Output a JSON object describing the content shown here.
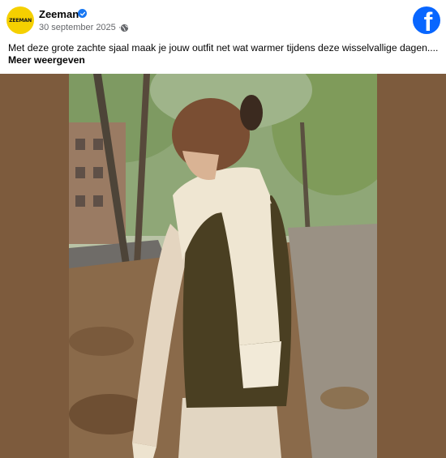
{
  "post": {
    "page_name": "Zeeman",
    "avatar_text": "ZEEMAN",
    "date": "30 september 2025 · ",
    "caption": "Met deze grote zachte sjaal maak je jouw outfit net wat warmer tijdens deze wisselvallige dagen....",
    "see_more": "Meer weergeven"
  },
  "icons": {
    "verified": "verified-badge-icon",
    "audience": "globe-icon",
    "platform": "facebook-logo-icon"
  },
  "colors": {
    "brand_yellow": "#f5d000",
    "facebook_blue": "#0866ff",
    "verified_blue": "#1877f2",
    "backdrop_brown": "#7d5b3d"
  }
}
